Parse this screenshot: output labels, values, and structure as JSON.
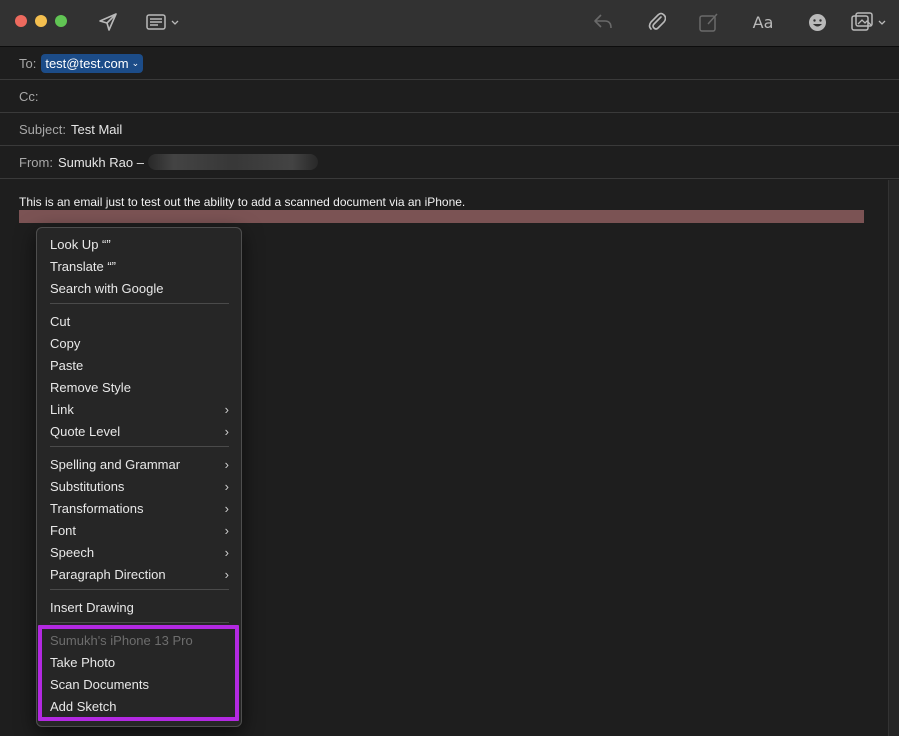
{
  "toolbar": {
    "icons": [
      "send-icon",
      "header-fields-icon",
      "reply-icon",
      "attachment-icon",
      "markup-icon",
      "format-icon",
      "emoji-icon",
      "photo-browser-icon"
    ],
    "format_label": "Aa"
  },
  "header": {
    "to_label": "To:",
    "to_value": "test@test.com",
    "cc_label": "Cc:",
    "subject_label": "Subject:",
    "subject_value": "Test Mail",
    "from_label": "From:",
    "from_value": "Sumukh Rao –"
  },
  "body": {
    "text": "This is an email just to test out the ability to add a scanned document via an iPhone."
  },
  "menu": {
    "group1": [
      "Look Up “”",
      "Translate “”",
      "Search with Google"
    ],
    "group2": [
      "Cut",
      "Copy",
      "Paste",
      "Remove Style",
      "Link",
      "Quote Level"
    ],
    "group3": [
      "Spelling and Grammar",
      "Substitutions",
      "Transformations",
      "Font",
      "Speech",
      "Paragraph Direction"
    ],
    "group4": [
      "Insert Drawing"
    ],
    "device_header": "Sumukh's iPhone 13 Pro",
    "device_items": [
      "Take Photo",
      "Scan Documents",
      "Add Sketch"
    ],
    "submenu_arrow": "›"
  },
  "colors": {
    "highlight_border": "#b329e2",
    "selection": "#7b5354",
    "to_chip": "#1c4c88"
  }
}
